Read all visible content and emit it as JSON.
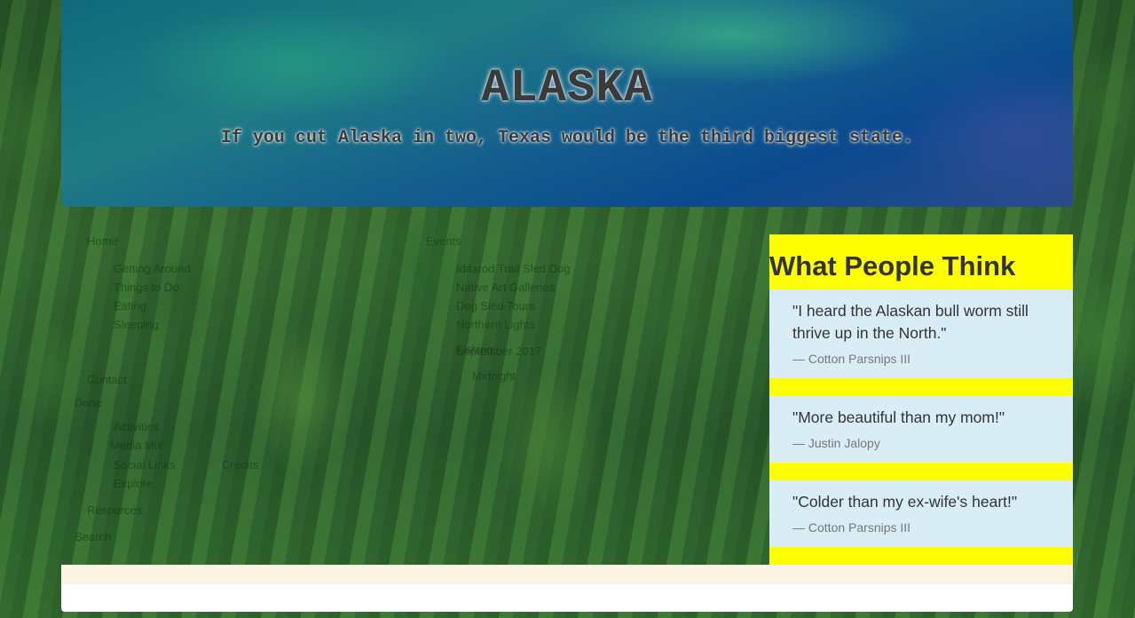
{
  "header": {
    "title": "ALASKA",
    "tagline": "If you cut Alaska in two, Texas would be the third biggest state."
  },
  "faint_nav": {
    "left": [
      "Home",
      "Getting Around",
      "Things to Do",
      "Eating",
      "Sleeping",
      "Contact",
      "Done",
      "Activities",
      "Media Mix",
      "Social Links",
      "Explore",
      "Resources",
      "Search",
      "Credits"
    ],
    "right": [
      "Events",
      "Iditarod Trail Sled Dog",
      "Native Art Galleries",
      "Dog Sled Tours",
      "Northern Lights",
      "Fishing",
      "September 2017",
      "Midnight"
    ]
  },
  "testimonials": {
    "heading": "What People Think",
    "quotes": [
      {
        "text": "\"I heard the Alaskan bull worm still thrive up in the North.\"",
        "author": "— Cotton Parsnips III"
      },
      {
        "text": "\"More beautiful than my mom!\"",
        "author": "— Justin Jalopy"
      },
      {
        "text": "\"Colder than my ex-wife's heart!\"",
        "author": "— Cotton Parsnips III"
      }
    ]
  },
  "colors": {
    "testimonial_bg": "#ffff00",
    "quote_bg": "#d9edf7",
    "footer_bar": "#fdf5e3"
  }
}
